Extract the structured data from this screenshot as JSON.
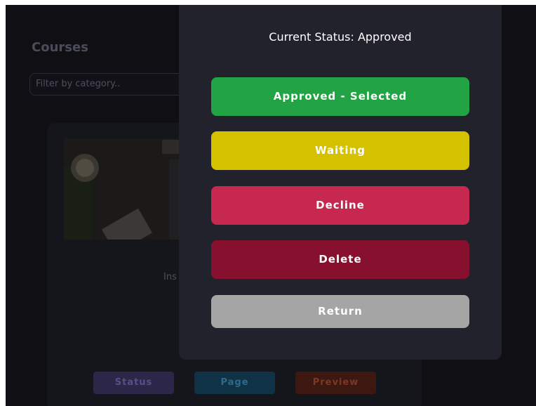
{
  "page": {
    "title": "Courses",
    "filter_placeholder": "Filter by category..",
    "card": {
      "text_fragment": "Ins",
      "buttons": {
        "status": "Status",
        "page": "Page",
        "preview": "Preview"
      }
    }
  },
  "modal": {
    "current_status": "Current Status: Approved",
    "buttons": {
      "approved": "Approved - Selected",
      "waiting": "Waiting",
      "decline": "Decline",
      "delete": "Delete",
      "return": "Return"
    }
  },
  "colors": {
    "approved": "#22a444",
    "waiting": "#d4c200",
    "decline": "#c7284f",
    "delete": "#86102e",
    "return": "#a5a5a5",
    "modal_bg": "#22222d"
  }
}
